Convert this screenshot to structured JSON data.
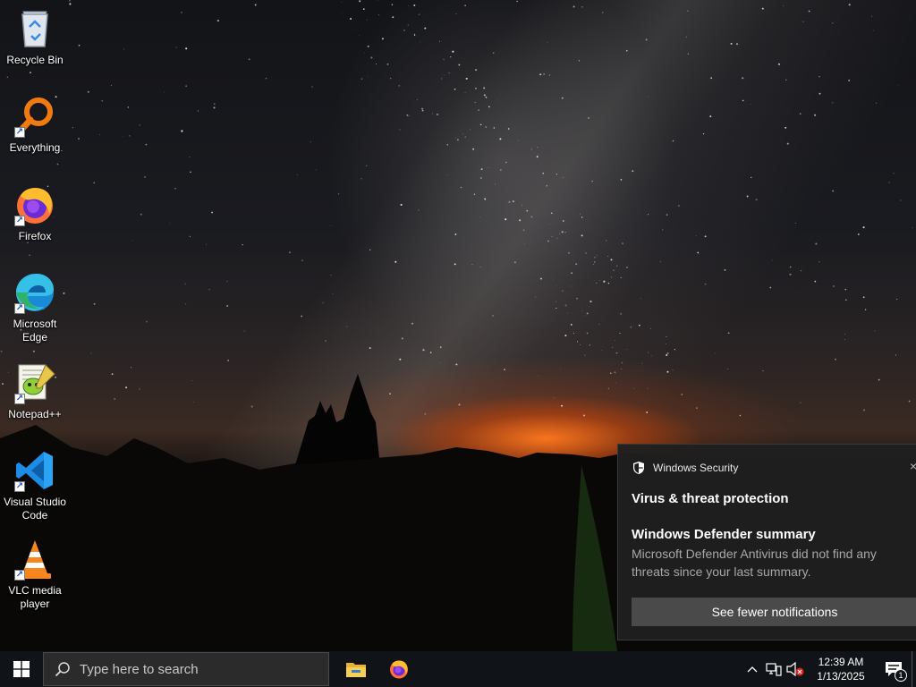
{
  "desktop": {
    "icons": [
      {
        "label": "Recycle Bin",
        "icon": "recycle-bin-icon"
      },
      {
        "label": "Everything",
        "icon": "everything-search-icon"
      },
      {
        "label": "Firefox",
        "icon": "firefox-icon"
      },
      {
        "label": "Microsoft Edge",
        "icon": "edge-icon"
      },
      {
        "label": "Notepad++",
        "icon": "notepadpp-icon"
      },
      {
        "label": "Visual Studio Code",
        "icon": "vscode-icon"
      },
      {
        "label": "VLC media player",
        "icon": "vlc-icon"
      }
    ]
  },
  "toast": {
    "app_name": "Windows Security",
    "close_glyph": "×",
    "title": "Virus & threat protection",
    "subtitle": "Windows Defender summary",
    "body": "Microsoft Defender Antivirus did not find any threats since your last summary.",
    "button_label": "See fewer notifications"
  },
  "taskbar": {
    "search_placeholder": "Type here to search",
    "pinned": [
      "file-explorer-icon",
      "firefox-icon"
    ],
    "tray": {
      "time": "12:39 AM",
      "date": "1/13/2025",
      "notification_count": "1"
    }
  },
  "colors": {
    "taskbar": "#101317",
    "toast_bg": "#1f1f1f",
    "toast_button": "#4a4a4a"
  }
}
